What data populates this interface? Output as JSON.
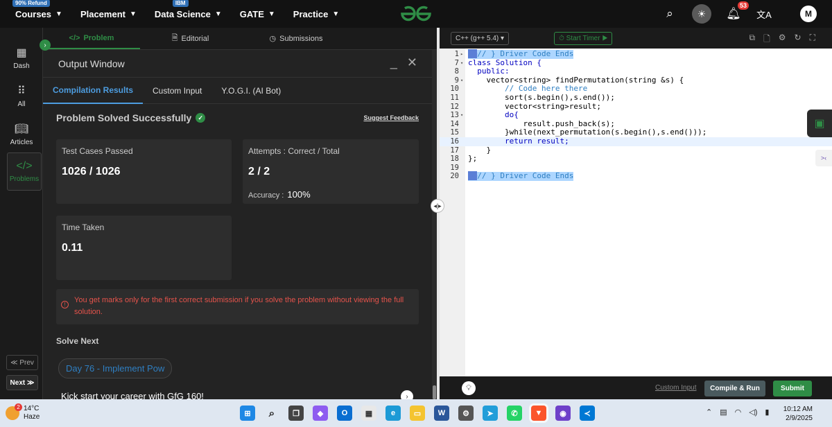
{
  "nav": {
    "items": [
      {
        "label": "Courses",
        "badge": "90% Refund"
      },
      {
        "label": "Placement",
        "badge": ""
      },
      {
        "label": "Data Science",
        "badge": "IBM"
      },
      {
        "label": "GATE",
        "badge": ""
      },
      {
        "label": "Practice",
        "badge": ""
      }
    ],
    "notification_count": "53",
    "avatar_initial": "M"
  },
  "sidebar": {
    "items": [
      {
        "label": "Dash",
        "icon": "dash-icon"
      },
      {
        "label": "All",
        "icon": "grid-icon"
      },
      {
        "label": "Articles",
        "icon": "book-icon"
      },
      {
        "label": "Problems",
        "icon": "code-icon"
      }
    ],
    "prev_label": "Prev",
    "next_label": "Next"
  },
  "problem_tabs": [
    "Problem",
    "Editorial",
    "Submissions"
  ],
  "output": {
    "title": "Output Window",
    "tabs": [
      "Compilation Results",
      "Custom Input",
      "Y.O.G.I. (AI Bot)"
    ],
    "status": "Problem Solved Successfully",
    "feedback": "Suggest Feedback",
    "test_cases_title": "Test Cases Passed",
    "test_cases_value": "1026 / 1026",
    "attempts_title": "Attempts : Correct / Total",
    "attempts_value": "2 / 2",
    "accuracy_label": "Accuracy :",
    "accuracy_value": "100%",
    "time_title": "Time Taken",
    "time_value": "0.11",
    "warning": "You get marks only for the first correct submission if you solve the problem without viewing the full solution.",
    "solve_next": "Solve Next",
    "next_problem": "Day 76 - Implement Pow",
    "promo": "Kick start your career with GfG 160!"
  },
  "editor": {
    "language": "C++ (g++ 5.4)",
    "timer": "Start Timer",
    "lines": [
      {
        "num": "1",
        "fold": "▸",
        "text": "// } Driver Code Ends"
      },
      {
        "num": "7",
        "fold": "▾",
        "text": "class Solution {"
      },
      {
        "num": "8",
        "fold": "",
        "text": "  public:"
      },
      {
        "num": "9",
        "fold": "▾",
        "text": "    vector<string> findPermutation(string &s) {"
      },
      {
        "num": "10",
        "fold": "",
        "text": "        // Code here there"
      },
      {
        "num": "11",
        "fold": "",
        "text": "        sort(s.begin(),s.end());"
      },
      {
        "num": "12",
        "fold": "",
        "text": "        vector<string>result;"
      },
      {
        "num": "13",
        "fold": "▾",
        "text": "        do{"
      },
      {
        "num": "14",
        "fold": "",
        "text": "            result.push_back(s);"
      },
      {
        "num": "15",
        "fold": "",
        "text": "        }while(next_permutation(s.begin(),s.end()));"
      },
      {
        "num": "16",
        "fold": "",
        "text": "        return result;"
      },
      {
        "num": "17",
        "fold": "",
        "text": "    }"
      },
      {
        "num": "18",
        "fold": "",
        "text": "};"
      },
      {
        "num": "19",
        "fold": "",
        "text": ""
      },
      {
        "num": "20",
        "fold": "",
        "text": "// } Driver Code Ends"
      }
    ],
    "custom_input": "Custom Input",
    "compile_run": "Compile & Run",
    "submit": "Submit"
  },
  "taskbar": {
    "temperature": "14°C",
    "weather": "Haze",
    "weather_badge": "2",
    "time": "10:12 AM",
    "date": "2/9/2025"
  },
  "colors": {
    "brand_green": "#2f8d46",
    "link_blue": "#4d9de0",
    "error_red": "#e5534b"
  }
}
